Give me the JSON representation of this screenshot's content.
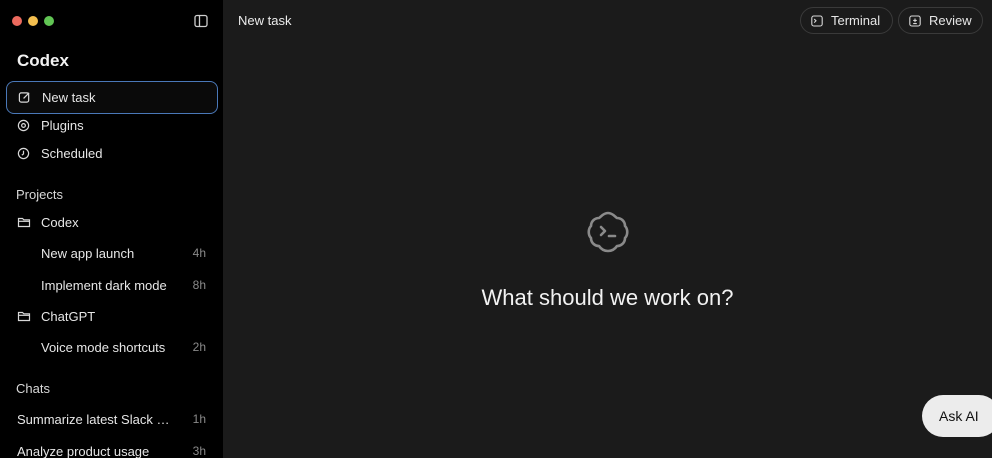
{
  "sidebar": {
    "app_title": "Codex",
    "nav": [
      {
        "label": "New task",
        "icon": "edit-icon",
        "active": true
      },
      {
        "label": "Plugins",
        "icon": "plugin-icon"
      },
      {
        "label": "Scheduled",
        "icon": "clock-icon"
      }
    ],
    "projects_label": "Projects",
    "projects": [
      {
        "name": "Codex",
        "icon": "folder-icon",
        "tasks": [
          {
            "title": "New app launch",
            "time": "4h"
          },
          {
            "title": "Implement dark mode",
            "time": "8h"
          }
        ]
      },
      {
        "name": "ChatGPT",
        "icon": "folder-icon",
        "tasks": [
          {
            "title": "Voice mode shortcuts",
            "time": "2h"
          }
        ]
      }
    ],
    "chats_label": "Chats",
    "chats": [
      {
        "title": "Summarize latest Slack m...",
        "time": "1h"
      },
      {
        "title": "Analyze product usage",
        "time": "3h"
      }
    ]
  },
  "header": {
    "title": "New task",
    "terminal_label": "Terminal",
    "review_label": "Review"
  },
  "main": {
    "prompt": "What should we work on?"
  },
  "ask_ai_label": "Ask AI",
  "colors": {
    "sidebar_bg": "#000000",
    "main_bg": "#1b1b1b",
    "active_border": "#4a78b8",
    "traffic_red": "#ec6a5e",
    "traffic_yellow": "#f4bf4f",
    "traffic_green": "#61c554"
  }
}
